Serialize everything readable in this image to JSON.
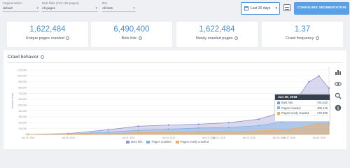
{
  "filters": {
    "segmentation": {
      "label": "Segmentation",
      "value": "default"
    },
    "bots_filter": {
      "label": "Bots filter (740,155 pages)",
      "value": "All pages"
    },
    "bot": {
      "label": "Bot",
      "value": "All bots"
    }
  },
  "toolbar": {
    "date_range": "Last 30 days",
    "table_icon": "table-icon",
    "configure_label": "CONFIGURE SEGMENTATION"
  },
  "colors": {
    "accent": "#4a8fd6",
    "bots_hits": "#8e92cf",
    "pages_crawled": "#7fb2e5",
    "pages_newly_crawled": "#f0ad5c"
  },
  "kpis": [
    {
      "value": "1,622,484",
      "label": "Unique pages crawled"
    },
    {
      "value": "6,490,400",
      "label": "Bots hits"
    },
    {
      "value": "1,622,484",
      "label": "Newly crawled pages"
    },
    {
      "value": "1.37",
      "label": "Crawl frequency"
    }
  ],
  "panel": {
    "title": "Crawl behavior"
  },
  "chart_data": {
    "type": "area",
    "title": "Crawl behavior",
    "ylabel": "Number of hits",
    "y_ticks": [
      "1,100,000",
      "1,000,000",
      "900,000",
      "800,000",
      "700,000",
      "600,000",
      "500,000",
      "400,000",
      "300,000",
      "200,000",
      "100,000",
      "0"
    ],
    "ylim": [
      0,
      1150000
    ],
    "x_ticks": [
      "Jun 01, 2018",
      "Jun 05, 2018",
      "Jun 11, 2018",
      "Jun 15, 2018",
      "Jun 19, 2018",
      "Jun 23, 2018",
      "Jun 27, 2018",
      "Jun 30, 2018"
    ],
    "x_tick_labels": [
      "Jun 01, 2018",
      "Jun 05, 2018",
      "Jun 11, 2018",
      "Jun 15, 2018",
      "Jun 19, 2018",
      "Jun 20, 2018",
      "Jun 23, 2018",
      "Jun 26, 2018",
      "Jun 27, 2018",
      "Jun 30, 2018"
    ],
    "x_index_max": 30,
    "series": [
      {
        "name": "Bots hits",
        "points": [
          [
            0,
            0
          ],
          [
            4,
            15000
          ],
          [
            8,
            80000
          ],
          [
            11,
            140000
          ],
          [
            14,
            160000
          ],
          [
            17,
            175000
          ],
          [
            20,
            200000
          ],
          [
            23,
            260000
          ],
          [
            26,
            420000
          ],
          [
            28,
            900000
          ],
          [
            29,
            1000000
          ],
          [
            30,
            791042
          ]
        ]
      },
      {
        "name": "Pages crawled",
        "points": [
          [
            0,
            0
          ],
          [
            4,
            5000
          ],
          [
            8,
            40000
          ],
          [
            11,
            70000
          ],
          [
            14,
            90000
          ],
          [
            17,
            110000
          ],
          [
            20,
            120000
          ],
          [
            23,
            150000
          ],
          [
            26,
            230000
          ],
          [
            28,
            420000
          ],
          [
            29,
            470000
          ],
          [
            30,
            405448
          ]
        ]
      },
      {
        "name": "Pages newly crawled",
        "points": [
          [
            0,
            0
          ],
          [
            4,
            2000
          ],
          [
            8,
            15000
          ],
          [
            11,
            30000
          ],
          [
            14,
            35000
          ],
          [
            17,
            45000
          ],
          [
            20,
            50000
          ],
          [
            23,
            60000
          ],
          [
            26,
            80000
          ],
          [
            28,
            150000
          ],
          [
            29,
            190000
          ],
          [
            30,
            178399
          ]
        ]
      }
    ],
    "legend_position": "bottom",
    "grid": true
  },
  "tooltip": {
    "date": "Jun 30, 2018",
    "rows": [
      {
        "label": "Bots hits",
        "value": "791,042"
      },
      {
        "label": "Pages crawled",
        "value": "405,448"
      },
      {
        "label": "Pages newly crawled",
        "value": "178,399"
      }
    ]
  },
  "side_icons": [
    "bar-chart-icon",
    "eye-icon",
    "search-icon",
    "info-icon"
  ]
}
